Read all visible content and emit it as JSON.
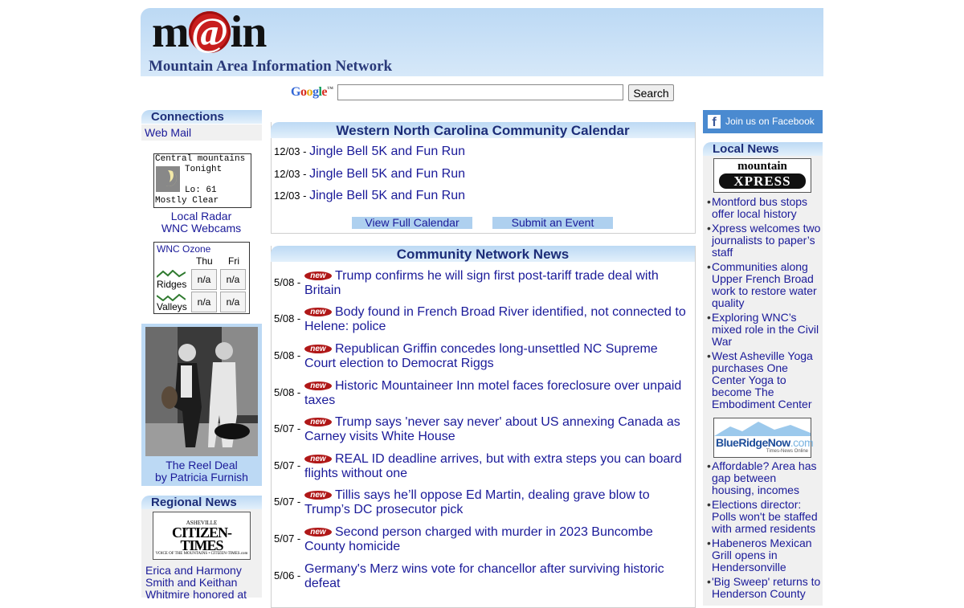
{
  "header": {
    "logo_pre": "m",
    "logo_at": "@",
    "logo_post": "in",
    "tagline": "Mountain Area Information Network"
  },
  "search": {
    "google_logo": "Google",
    "google_tm": "™",
    "button_label": "Search",
    "value": ""
  },
  "left": {
    "connections_title": "Connections",
    "webmail": "Web Mail",
    "weather": {
      "location": "Central mountains",
      "period": "Tonight",
      "low": "Lo: 61",
      "condition": "Mostly Clear"
    },
    "local_radar": "Local Radar",
    "webcams": "WNC Webcams",
    "ozone": {
      "title": "WNC Ozone",
      "days": [
        "Thu",
        "Fri"
      ],
      "rows": [
        {
          "label": "Ridges",
          "values": [
            "n/a",
            "n/a"
          ]
        },
        {
          "label": "Valleys",
          "values": [
            "n/a",
            "n/a"
          ]
        }
      ]
    },
    "reel_deal_line1": "The Reel Deal",
    "reel_deal_line2": "by Patricia Furnish",
    "regional_title": "Regional News",
    "citizen_logo": {
      "top": "ASHEVILLE",
      "name": "CITIZEN-TIMES",
      "sub": "VOICE OF THE MOUNTAINS • CITIZEN-TIMES.com"
    },
    "regional_story": "Erica and Harmony Smith and Keithan Whitmire honored at"
  },
  "calendar": {
    "title": "Western North Carolina Community Calendar",
    "events": [
      {
        "date": "12/03 -",
        "title": "Jingle Bell 5K and Fun Run"
      },
      {
        "date": "12/03 -",
        "title": "Jingle Bell 5K and Fun Run"
      },
      {
        "date": "12/03 -",
        "title": "Jingle Bell 5K and Fun Run"
      }
    ],
    "view_full": "View Full Calendar",
    "submit": "Submit an Event"
  },
  "news": {
    "title": "Community Network News",
    "badge": "new",
    "items": [
      {
        "date": "5/08 -",
        "new": true,
        "title": "Trump confirms he will sign first post-tariff trade deal with Britain"
      },
      {
        "date": "5/08 -",
        "new": true,
        "title": "Body found in French Broad River identified, not connected to Helene: police"
      },
      {
        "date": "5/08 -",
        "new": true,
        "title": "Republican Griffin concedes long-unsettled NC Supreme Court election to Democrat Riggs"
      },
      {
        "date": "5/08 -",
        "new": true,
        "title": "Historic Mountaineer Inn motel faces foreclosure over unpaid taxes"
      },
      {
        "date": "5/07 -",
        "new": true,
        "title": "Trump says 'never say never' about US annexing Canada as Carney visits White House"
      },
      {
        "date": "5/07 -",
        "new": true,
        "title": "REAL ID deadline arrives, but with extra steps you can board flights without one"
      },
      {
        "date": "5/07 -",
        "new": true,
        "title": "Tillis says he’ll oppose Ed Martin, dealing grave blow to Trump’s DC prosecutor pick"
      },
      {
        "date": "5/07 -",
        "new": true,
        "title": "Second person charged with murder in 2023 Buncombe County homicide"
      },
      {
        "date": "5/06 -",
        "new": false,
        "title": "Germany's Merz wins vote for chancellor after surviving historic defeat"
      }
    ]
  },
  "right": {
    "facebook": "Join us on Facebook",
    "facebook_icon": "f",
    "local_title": "Local News",
    "xpress_logo": {
      "top": "mountain",
      "bottom": "XPRESS"
    },
    "xpress_items": [
      "Montford bus stops offer local history",
      "Xpress welcomes two journalists to paper’s staff",
      "Communities along Upper French Broad work to restore water quality",
      "Exploring WNC’s mixed role in the Civil War",
      "West Asheville Yoga purchases One Center Yoga to become The Embodiment Center"
    ],
    "brn_logo": {
      "name": "BlueRidgeNow",
      "tld": ".com",
      "sub": "Times-News Online"
    },
    "brn_items": [
      "Affordable? Area has gap between housing, incomes",
      "Elections director: Polls won't be staffed with armed residents",
      "Habeneros Mexican Grill opens in Hendersonville",
      "'Big Sweep' returns to Henderson County"
    ]
  }
}
